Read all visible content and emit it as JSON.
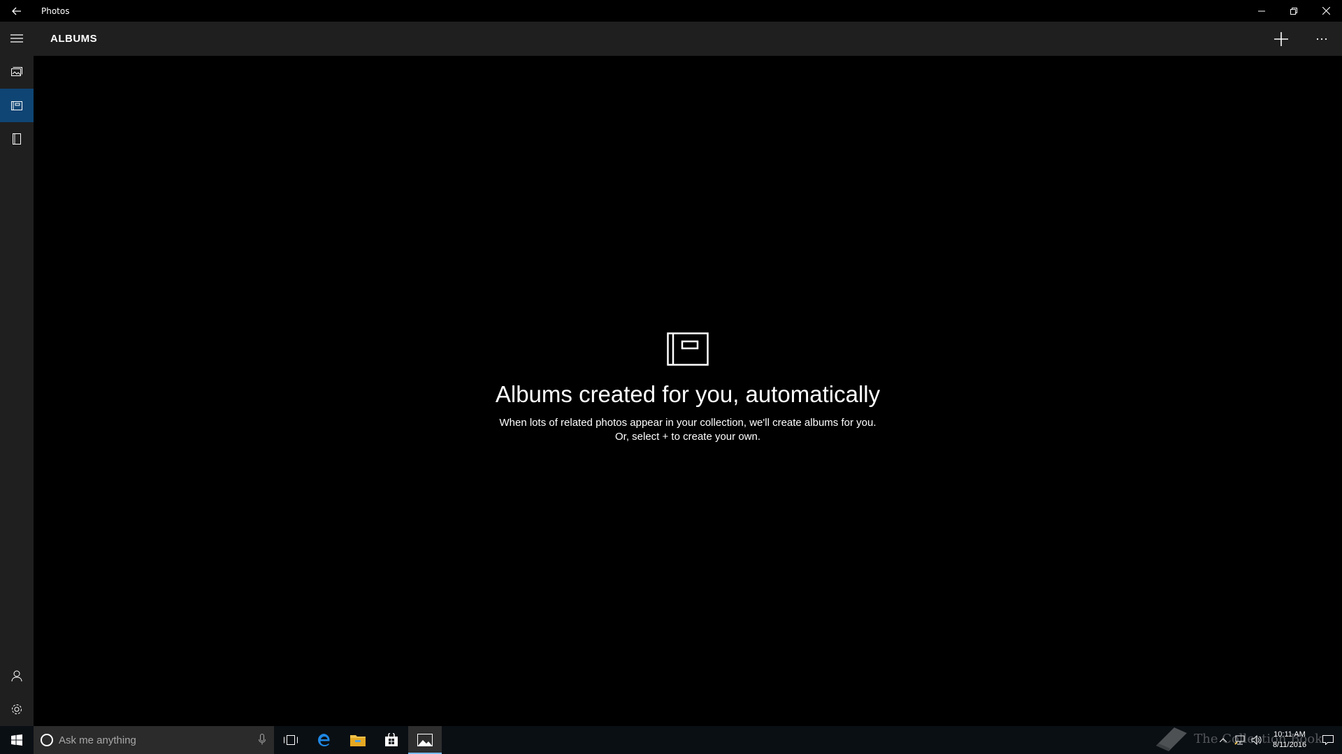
{
  "window": {
    "title": "Photos",
    "back_icon": "back-arrow-icon",
    "controls": [
      "minimize-icon",
      "restore-icon",
      "close-icon"
    ]
  },
  "header": {
    "title": "ALBUMS",
    "actions": [
      "add-icon",
      "more-icon"
    ]
  },
  "nav": {
    "items": [
      {
        "icon": "hamburger-icon"
      },
      {
        "icon": "collection-icon"
      },
      {
        "icon": "albums-icon",
        "active": true
      },
      {
        "icon": "folders-icon"
      }
    ],
    "bottom": [
      {
        "icon": "account-icon"
      },
      {
        "icon": "settings-icon"
      }
    ]
  },
  "empty_state": {
    "icon": "album-icon",
    "heading": "Albums created for you, automatically",
    "line1": "When lots of related photos appear in your collection, we'll create albums for you.",
    "line2": "Or, select + to create your own."
  },
  "taskbar": {
    "search_placeholder": "Ask me anything",
    "apps": [
      "task-view-icon",
      "edge-icon",
      "file-explorer-icon",
      "store-icon",
      "photos-icon"
    ],
    "active_app": "photos-icon",
    "time": "10:11 AM",
    "date": "8/11/2016",
    "watermark": "The Collection Book",
    "accent_color": "#76b9ed"
  },
  "colors": {
    "background": "#000000",
    "rail": "#1f1f1f",
    "nav_active": "#0f4574"
  }
}
